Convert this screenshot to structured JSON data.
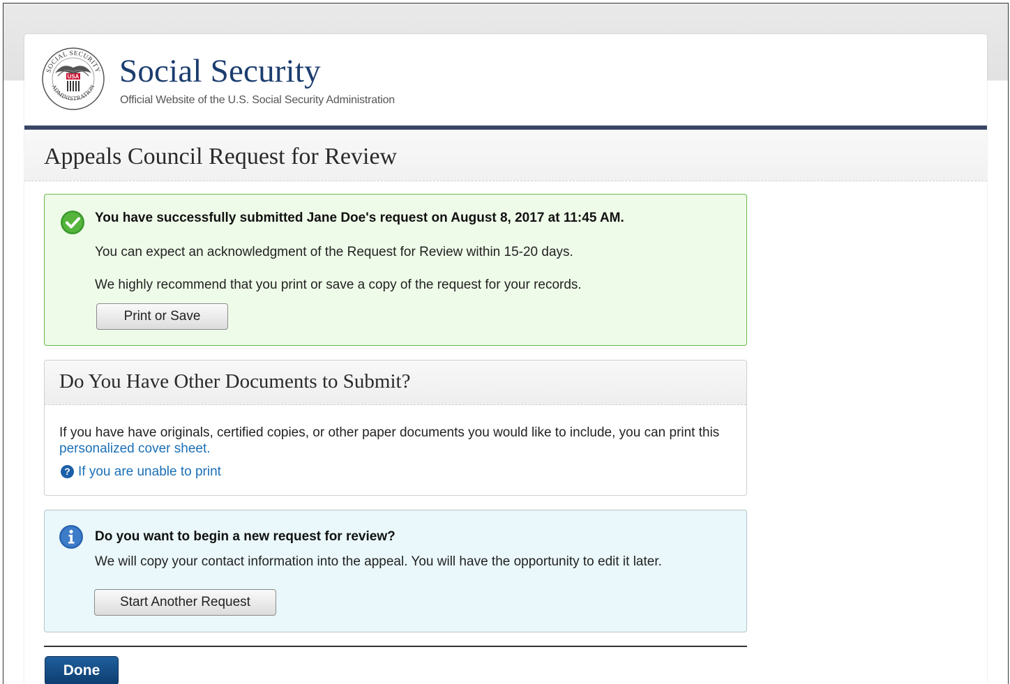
{
  "header": {
    "brand_title": "Social Security",
    "brand_subtitle": "Official Website of the U.S. Social Security Administration",
    "seal": {
      "top_text": "SOCIAL SECURITY",
      "bottom_text": "ADMINISTRATION",
      "center_text": "USA"
    }
  },
  "page": {
    "title": "Appeals Council Request for Review"
  },
  "success_panel": {
    "heading": "You have successfully submitted Jane Doe's request on August 8, 2017 at 11:45 AM.",
    "line1": "You can expect an acknowledgment of the Request for Review within 15-20 days.",
    "line2": "We highly recommend that you print or save a copy of the request for your records.",
    "print_button": "Print or Save"
  },
  "documents_panel": {
    "title": "Do You Have Other Documents to Submit?",
    "text_before_link": "If you have have originals, certified copies, or other paper documents you would like to include, you can print this ",
    "cover_sheet_link": "personalized cover sheet.",
    "help_icon_glyph": "?",
    "unable_link": "If you are unable to print"
  },
  "info_panel": {
    "heading": "Do you want to begin a new request for review?",
    "text": "We will copy your contact information into the appeal. You will have the opportunity to edit it later.",
    "start_button": "Start Another Request"
  },
  "footer": {
    "done_button": "Done"
  },
  "colors": {
    "brand_navy": "#1c3d6e",
    "header_rule": "#394766",
    "success_bg": "#effbe9",
    "success_border": "#67b94a",
    "info_bg": "#eaf8fb",
    "link": "#1a6fb7",
    "done_button": "#154b82"
  }
}
